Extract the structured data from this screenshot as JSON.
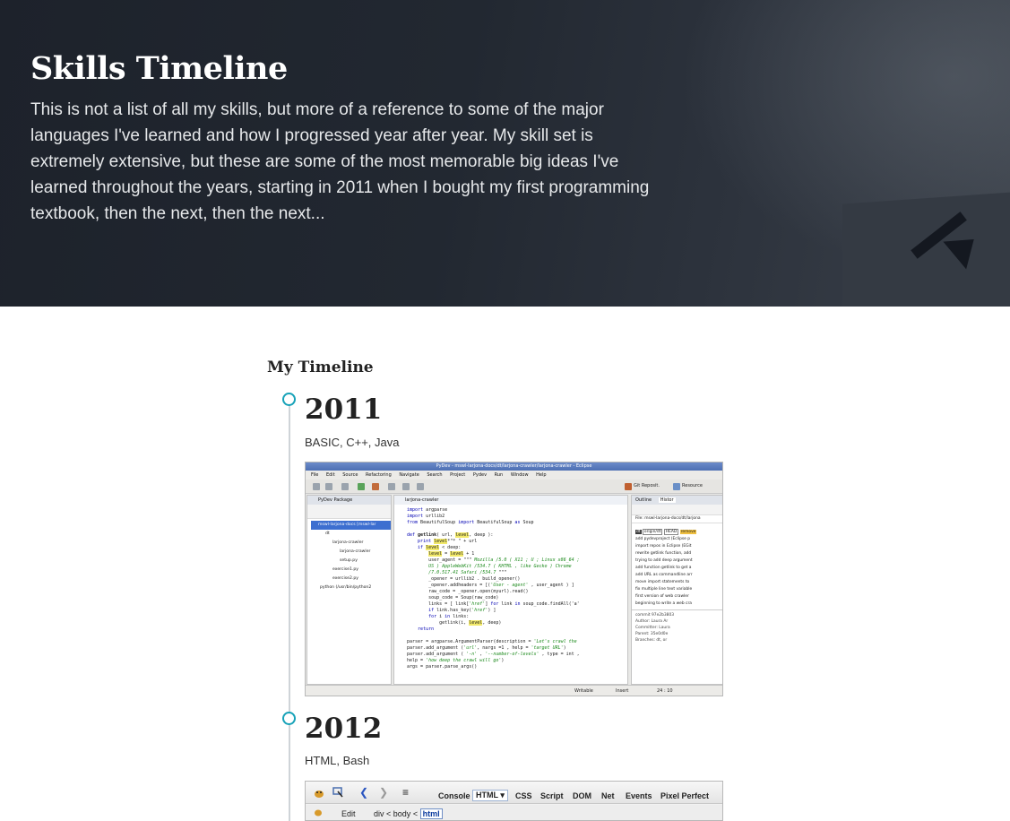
{
  "hero": {
    "title": "Skills Timeline",
    "description": "This is not a list of all my skills, but more of a reference to some of the major languages I've learned and how I progressed year after year. My skill set is extremely extensive, but these are some of the most memorable big ideas I've learned throughout the years, starting in 2011 when I bought my first programming textbook, then the next, then the next..."
  },
  "timeline": {
    "title": "My Timeline",
    "accent_color": "#17a2b8",
    "entries": [
      {
        "year": "2011",
        "skills": "BASIC, C++, Java"
      },
      {
        "year": "2012",
        "skills": "HTML, Bash"
      }
    ]
  },
  "eclipse": {
    "window_title": "PyDev - mswl-larjona-docs/dt/larjona-crawler/larjona-crawler - Eclipse",
    "menu": [
      "File",
      "Edit",
      "Source",
      "Refactoring",
      "Navigate",
      "Search",
      "Project",
      "Pydev",
      "Run",
      "Window",
      "Help"
    ],
    "toolbar_right": [
      "Git Reposit.",
      "Resource"
    ],
    "left_pane": {
      "tab": "PyDev Package",
      "tree": [
        "mswl-larjona-docs [mswl-lar",
        "dt",
        "larjona-crawler",
        "larjona-crawler",
        "setup.py",
        "exercise1.py",
        "exercise2.py",
        "python (/usr/bin/python2"
      ]
    },
    "editor": {
      "tab": "larjona-crawler",
      "code": [
        "import argparse",
        "import urllib2",
        "from BeautifulSoup import BeautifulSoup as Soup",
        "",
        "def getlink( url, level, deep ):",
        "    print level*\"* \" + url",
        "    if level < deep:",
        "        level = level + 1",
        "        user_agent = \"\"\" Mozilla /5.0 ( X11 ; U ; Linux x86_64 ;",
        "        US ) AppleWebKit /534.7 ( KHTML , like Gecko ) Chrome",
        "        /7.0.517.41 Safari /534.7 \"\"\"",
        "        _opener = urllib2 . build_opener()",
        "        _opener.addheaders = [('User - agent' , user_agent ) ]",
        "        raw_code = _opener.open(myurl).read()",
        "        soup_code = Soup(raw_code)",
        "        links = [ link['href'] for link in soup_code.findAll('a'",
        "        if link.has_key('href') ]",
        "        for i in links:",
        "            getlink(i, level, deep)",
        "    return",
        "",
        "parser = argparse.ArgumentParser(description = 'Let's crawl the",
        "parser.add_argument ('url', nargs =1 , help = 'target URL')",
        "parser.add_argument ( '-n' , '--number-of-levels' , type = int ,",
        "help = 'how deep the crawl will go')",
        "args = parser.parse_args()",
        "myurl = args.url[0]"
      ]
    },
    "right_pane": {
      "tabs": [
        "Outline",
        "Histor"
      ],
      "path": "File: mswl-larjona-docs/dt/larjona",
      "branch_labels": [
        "dt",
        "origin/dt",
        "HEAD",
        "remove"
      ],
      "history": [
        "add pydevproject (Eclipse p",
        "import repos in Eclipse (EGit",
        "rewrite getlink function, add",
        "trying to add deep argument",
        "add function getlink to get a",
        "add URL as commandline arr",
        "move import statements to",
        "fix multiple line text variable",
        "first version of web crawler",
        "beginning to write a web cra"
      ],
      "info": [
        "commit 97e2b3803",
        "Author: Laura Ar",
        "Committer: Laura",
        "Parent: 35e0d0e",
        "Branches: dt, or"
      ]
    },
    "status": {
      "writable": "Writable",
      "insert": "Insert",
      "position": "24 : 10"
    }
  },
  "firebug": {
    "tabs": [
      "Console",
      "HTML",
      "CSS",
      "Script",
      "DOM",
      "Net",
      "Events",
      "Pixel Perfect"
    ],
    "selected_tab": "HTML",
    "edit_label": "Edit",
    "breadcrumb": [
      "div",
      "body",
      "html"
    ]
  }
}
